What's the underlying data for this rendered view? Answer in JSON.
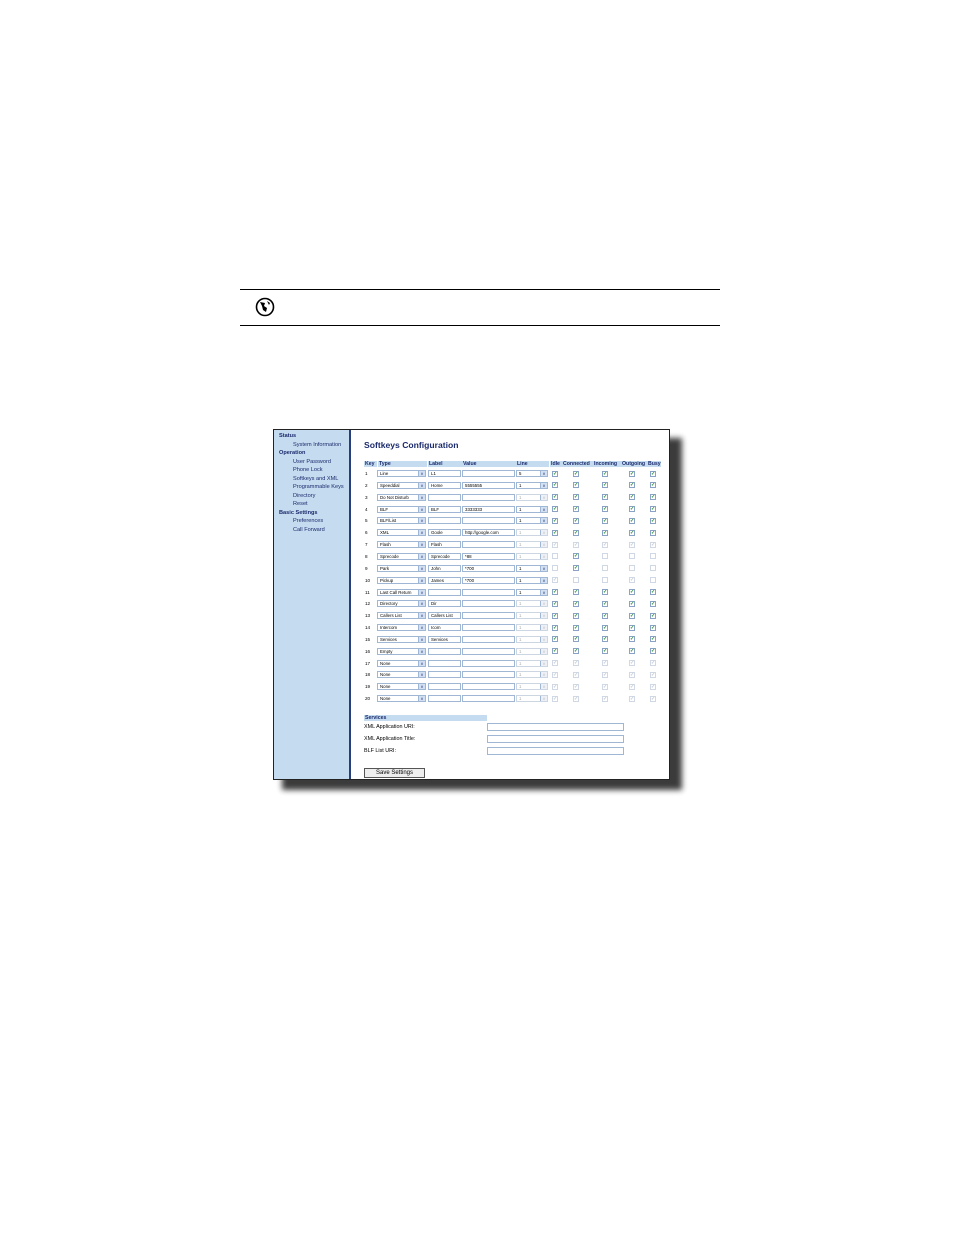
{
  "sidebar": {
    "items": [
      {
        "label": "Status",
        "header": true
      },
      {
        "label": "System Information",
        "header": false
      },
      {
        "label": "Operation",
        "header": true
      },
      {
        "label": "User Password",
        "header": false
      },
      {
        "label": "Phone Lock",
        "header": false
      },
      {
        "label": "Softkeys and XML",
        "header": false
      },
      {
        "label": "Programmable Keys",
        "header": false
      },
      {
        "label": "Directory",
        "header": false
      },
      {
        "label": "Reset",
        "header": false
      },
      {
        "label": "Basic Settings",
        "header": true
      },
      {
        "label": "Preferences",
        "header": false
      },
      {
        "label": "Call Forward",
        "header": false
      }
    ]
  },
  "main": {
    "title": "Softkeys Configuration",
    "columns": [
      "Key",
      "Type",
      "Label",
      "Value",
      "Line",
      "Idle",
      "Connected",
      "Incoming",
      "Outgoing",
      "Busy"
    ],
    "rows": [
      {
        "key": "1",
        "type": "Line",
        "label": "L1",
        "value": "",
        "line": "5",
        "line_enabled": true,
        "states": [
          1,
          1,
          1,
          1,
          1
        ],
        "states_enabled": true
      },
      {
        "key": "2",
        "type": "Speeddial",
        "label": "Home",
        "value": "5555555",
        "line": "1",
        "line_enabled": true,
        "states": [
          1,
          1,
          1,
          1,
          1
        ],
        "states_enabled": true
      },
      {
        "key": "3",
        "type": "Do Not Disturb",
        "label": "",
        "value": "",
        "line": "1",
        "line_enabled": false,
        "states": [
          1,
          1,
          1,
          1,
          1
        ],
        "states_enabled": true
      },
      {
        "key": "4",
        "type": "BLF",
        "label": "BLF",
        "value": "3333333",
        "line": "1",
        "line_enabled": true,
        "states": [
          1,
          1,
          1,
          1,
          1
        ],
        "states_enabled": true
      },
      {
        "key": "5",
        "type": "BLF/List",
        "label": "",
        "value": "",
        "line": "1",
        "line_enabled": true,
        "states": [
          1,
          1,
          1,
          1,
          1
        ],
        "states_enabled": true
      },
      {
        "key": "6",
        "type": "XML",
        "label": "Goole",
        "value": "http://google.com",
        "line": "1",
        "line_enabled": false,
        "states": [
          1,
          1,
          1,
          1,
          1
        ],
        "states_enabled": true
      },
      {
        "key": "7",
        "type": "Flash",
        "label": "Flash",
        "value": "",
        "line": "1",
        "line_enabled": false,
        "states": [
          1,
          1,
          1,
          1,
          1
        ],
        "states_enabled": false
      },
      {
        "key": "8",
        "type": "Sprecode",
        "label": "Sprecode",
        "value": "*88",
        "line": "1",
        "line_enabled": false,
        "states": [
          0,
          1,
          0,
          0,
          0
        ],
        "states_enabled": "connected"
      },
      {
        "key": "9",
        "type": "Park",
        "label": "John",
        "value": "*700",
        "line": "1",
        "line_enabled": true,
        "states": [
          0,
          1,
          0,
          0,
          0
        ],
        "states_enabled": "connected"
      },
      {
        "key": "10",
        "type": "Pickup",
        "label": "James",
        "value": "*700",
        "line": "1",
        "line_enabled": true,
        "states": [
          1,
          0,
          0,
          1,
          0
        ],
        "states_enabled": "idle-outgoing"
      },
      {
        "key": "11",
        "type": "Last Call Return",
        "label": "",
        "value": "",
        "line": "1",
        "line_enabled": true,
        "states": [
          1,
          1,
          1,
          1,
          1
        ],
        "states_enabled": true
      },
      {
        "key": "12",
        "type": "Directory",
        "label": "Dir",
        "value": "",
        "line": "1",
        "line_enabled": false,
        "states": [
          1,
          1,
          1,
          1,
          1
        ],
        "states_enabled": true
      },
      {
        "key": "13",
        "type": "Callers List",
        "label": "Callers List",
        "value": "",
        "line": "1",
        "line_enabled": false,
        "states": [
          1,
          1,
          1,
          1,
          1
        ],
        "states_enabled": true
      },
      {
        "key": "14",
        "type": "Intercom",
        "label": "Icom",
        "value": "",
        "line": "1",
        "line_enabled": false,
        "states": [
          1,
          1,
          1,
          1,
          1
        ],
        "states_enabled": true
      },
      {
        "key": "15",
        "type": "Services",
        "label": "Services",
        "value": "",
        "line": "1",
        "line_enabled": false,
        "states": [
          1,
          1,
          1,
          1,
          1
        ],
        "states_enabled": true
      },
      {
        "key": "16",
        "type": "Empty",
        "label": "",
        "value": "",
        "line": "1",
        "line_enabled": false,
        "states": [
          1,
          1,
          1,
          1,
          1
        ],
        "states_enabled": true
      },
      {
        "key": "17",
        "type": "None",
        "label": "",
        "value": "",
        "line": "1",
        "line_enabled": false,
        "states": [
          1,
          1,
          1,
          1,
          1
        ],
        "states_enabled": false
      },
      {
        "key": "18",
        "type": "None",
        "label": "",
        "value": "",
        "line": "1",
        "line_enabled": false,
        "states": [
          1,
          1,
          1,
          1,
          1
        ],
        "states_enabled": false
      },
      {
        "key": "19",
        "type": "None",
        "label": "",
        "value": "",
        "line": "1",
        "line_enabled": false,
        "states": [
          1,
          1,
          1,
          1,
          1
        ],
        "states_enabled": false
      },
      {
        "key": "20",
        "type": "None",
        "label": "",
        "value": "",
        "line": "1",
        "line_enabled": false,
        "states": [
          1,
          1,
          1,
          1,
          1
        ],
        "states_enabled": false
      }
    ],
    "services": {
      "header": "Services",
      "fields": [
        {
          "label": "XML Application URI:",
          "value": ""
        },
        {
          "label": "XML Application Title:",
          "value": ""
        },
        {
          "label": "BLF List URI:",
          "value": ""
        }
      ]
    },
    "save_label": "Save Settings"
  },
  "icons": {
    "web_ui": "web-ui-globe-icon",
    "dropdown": "chevron-down-icon",
    "checkbox": "checkmark-icon"
  },
  "colors": {
    "sidebar_bg": "#c5dcf0",
    "accent_text": "#1a2a6c",
    "check": "#1f8a2f"
  }
}
